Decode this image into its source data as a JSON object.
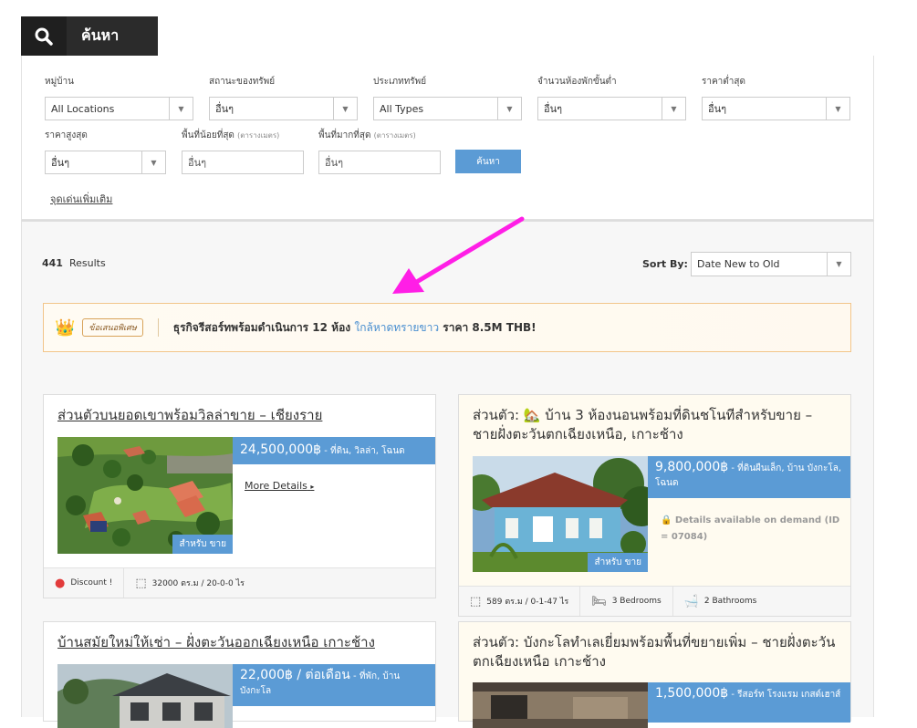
{
  "search": {
    "tab_label": "ค้นหา",
    "fields": {
      "village": {
        "label": "หมู่บ้าน",
        "value": "All Locations"
      },
      "status": {
        "label": "สถานะของทรัพย์",
        "value": "อื่นๆ"
      },
      "type": {
        "label": "ประเภททรัพย์",
        "value": "All Types"
      },
      "bedrooms": {
        "label": "จำนวนห้องพักขั้นต่ำ",
        "value": "อื่นๆ"
      },
      "min_price": {
        "label": "ราคาต่ำสุด",
        "value": "อื่นๆ"
      },
      "max_price": {
        "label": "ราคาสูงสุด",
        "value": "อื่นๆ"
      },
      "min_area": {
        "label": "พื้นที่น้อยที่สุด",
        "unit": "(ตารางเมตร)",
        "placeholder": "อื่นๆ"
      },
      "max_area": {
        "label": "พื้นที่มากที่สุด",
        "unit": "(ตารางเมตร)",
        "placeholder": "อื่นๆ"
      }
    },
    "button": "ค้นหา",
    "more_link": "จุดเด่นเพิ่มเติม"
  },
  "results": {
    "count": "441",
    "count_label": "Results",
    "sort_label": "Sort By:",
    "sort_value": "Date New to Old"
  },
  "banner": {
    "badge": "ข้อเสนอพิเศษ",
    "text_before": "ธุรกิจรีสอร์ทพร้อมดำเนินการ 12 ห้อง ",
    "link": "ใกล้หาดทรายขาว",
    "text_after": " ราคา 8.5M THB!"
  },
  "listings": [
    {
      "title": "ส่วนตัวบนยอดเขาพร้อมวิลล่าขาย – เชียงราย",
      "price": "24,500,000฿",
      "price_desc": " - ที่ดิน, วิลล่า, โฉนด",
      "tag": "สำหรับ ขาย",
      "more": "More Details",
      "footer": {
        "discount": "Discount !",
        "area": "32000 ตร.ม / 20-0-0 ไร"
      }
    },
    {
      "title": "ส่วนตัว: 🏡 บ้าน 3 ห้องนอนพร้อมที่ดินชโนทีสำหรับขาย – ชายฝั่งตะวันตกเฉียงเหนือ, เกาะช้าง",
      "price": "9,800,000฿",
      "price_desc": " - ที่ดินผืนเล็ก, บ้าน บังกะโล, โฉนด",
      "tag": "สำหรับ ขาย",
      "demand": "🔒 Details available on demand (ID = 07084)",
      "footer": {
        "area": "589 ตร.ม / 0-1-47 ไร",
        "bedrooms": "3 Bedrooms",
        "bathrooms": "2 Bathrooms"
      }
    },
    {
      "title": "บ้านสมัยใหม่ให้เช่า – ฝั่งตะวันออกเฉียงเหนือ เกาะช้าง",
      "price": "22,000฿ / ต่อเดือน",
      "price_desc": " - ที่พัก, บ้าน บังกะโล"
    },
    {
      "title": "ส่วนตัว: บังกะโลทำเลเยี่ยมพร้อมพื้นที่ขยายเพิ่ม – ชายฝั่งตะวันตกเฉียงเหนือ เกาะช้าง",
      "price": "1,500,000฿",
      "price_desc": " - รีสอร์ท โรงแรม เกสต์เฮาส์"
    }
  ],
  "colors": {
    "accent": "#5b9bd5",
    "annotation_arrow": "#ff1ee6",
    "banner_border": "#f2c58a"
  }
}
